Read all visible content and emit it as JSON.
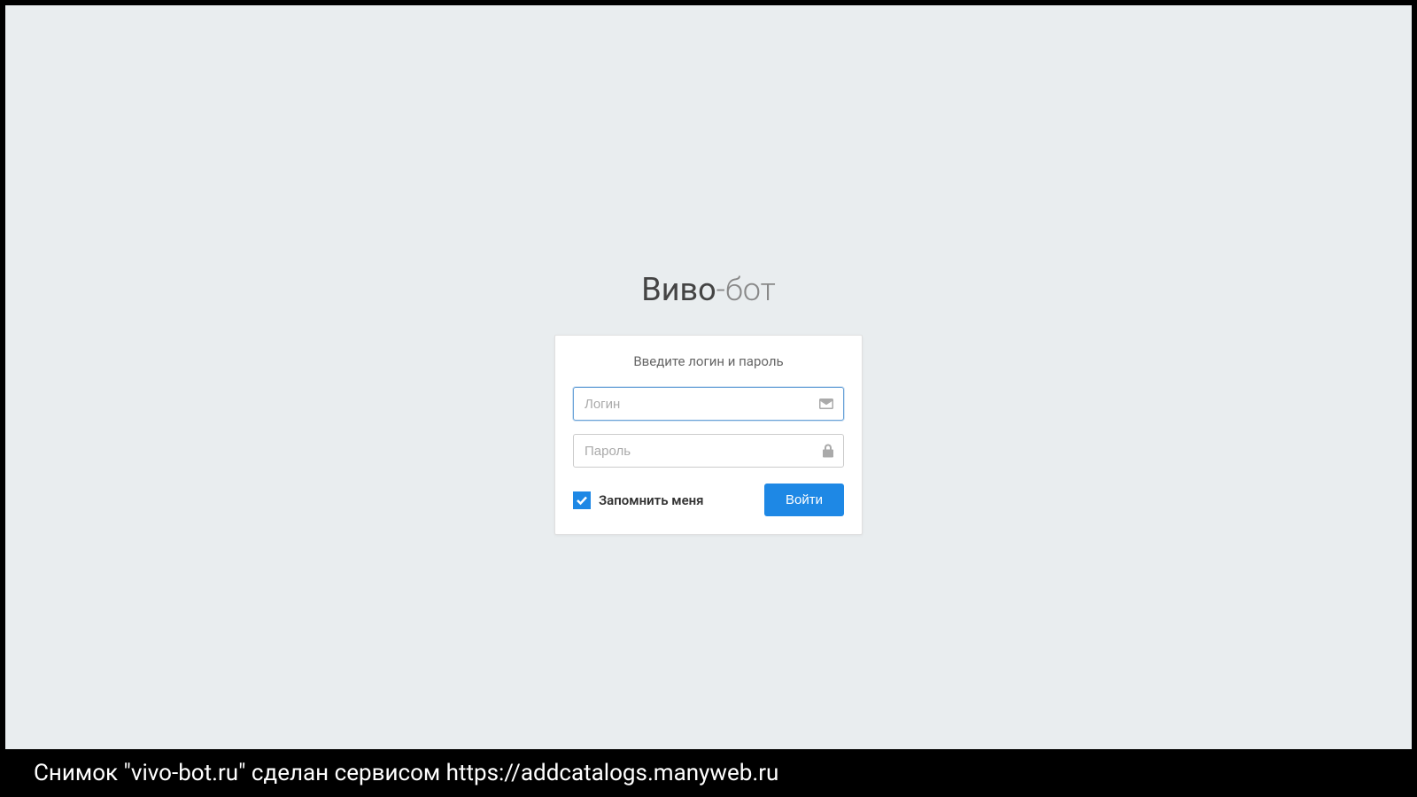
{
  "title": {
    "bold": "Виво",
    "light": "-бот"
  },
  "login": {
    "subtitle": "Введите логин и пароль",
    "username_placeholder": "Логин",
    "password_placeholder": "Пароль",
    "remember_label": "Запомнить меня",
    "remember_checked": true,
    "submit_label": "Войти"
  },
  "footer": {
    "caption": "Снимок \"vivo-bot.ru\" сделан сервисом https://addcatalogs.manyweb.ru"
  }
}
